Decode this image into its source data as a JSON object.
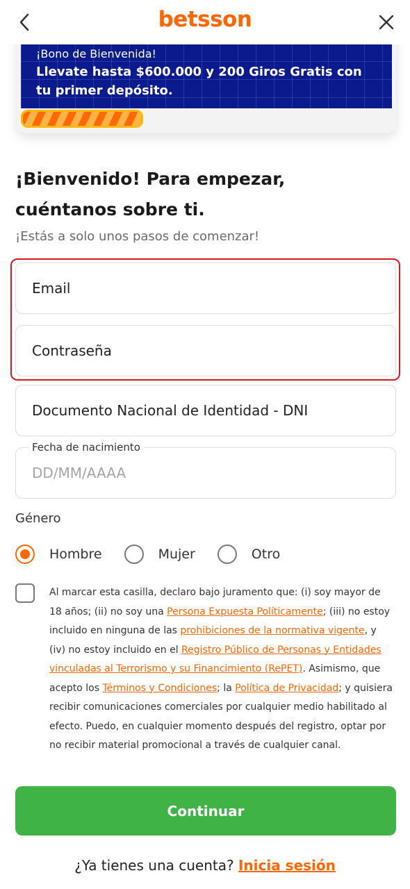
{
  "header": {
    "logo_text": "betsson",
    "back_icon": "chevron-left-icon",
    "close_icon": "close-icon",
    "brand_color": "#ff6600"
  },
  "banner": {
    "subtitle": "¡Bono de Bienvenida!",
    "headline": "Llevate hasta $600.000 y 200 Giros Gratis con tu primer depósito.",
    "background_color": "#0b1a8c"
  },
  "form": {
    "title": "¡Bienvenido! Para empezar, cuéntanos sobre ti.",
    "subtitle": "¡Estás a solo unos pasos de comenzar!",
    "email_placeholder": "Email",
    "password_placeholder": "Contraseña",
    "dni_placeholder": "Documento Nacional de Identidad - DNI",
    "birthdate_label": "Fecha de nacimiento",
    "birthdate_placeholder": "DD/MM/AAAA",
    "gender_label": "Género",
    "gender_options": [
      "Hombre",
      "Mujer",
      "Otro"
    ],
    "gender_selected": "Hombre",
    "highlight_color": "#d9181e"
  },
  "legal": {
    "checked": false,
    "text_1": "Al marcar esta casilla, declaro bajo juramento que: (i) soy mayor de 18 años; (ii) no soy una ",
    "link_pep": "Persona Expuesta Políticamente",
    "text_2": "; (iii) no estoy incluido en ninguna de las ",
    "link_prohibiciones": "prohibiciones de la normativa vigente",
    "text_3": ", y (iv) no estoy incluido en el ",
    "link_repet": "Registro Público de Personas y Entidades vinculadas al Terrorismo y su Financimiento (RePET)",
    "text_4": ". Asimismo, que acepto los ",
    "link_terminos": "Términos y Condiciones",
    "text_5": "; la ",
    "link_privacidad": "Política de Privacidad",
    "text_6": "; y quisiera recibir comunicaciones comerciales por cualquier medio habilitado al efecto. Puedo, en cualquier momento después del registro, optar por no recibir material promocional a través de cualquier canal."
  },
  "actions": {
    "continue_label": "Continuar",
    "continue_color": "#40b346",
    "login_prompt": "¿Ya tienes una cuenta?",
    "login_link": "Inicia sesión"
  }
}
